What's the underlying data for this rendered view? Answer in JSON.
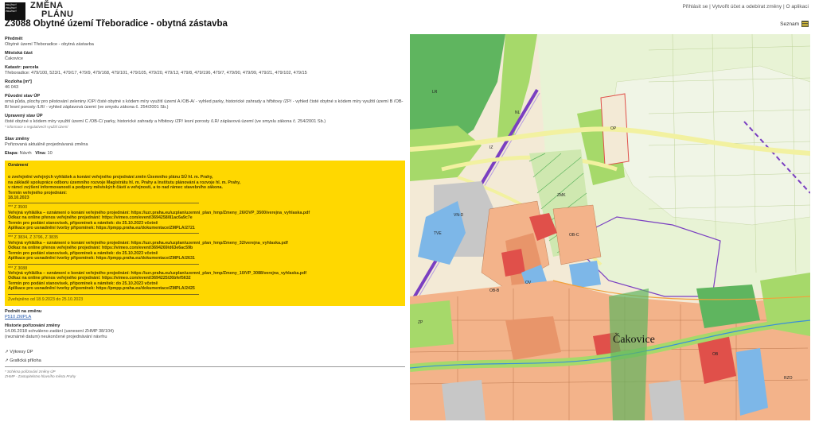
{
  "header": {
    "logo_words": [
      "PRAŽSKÝ",
      "PRAŽSKÝ",
      "PRAŽSKÝ"
    ],
    "logo_line1": "ZMĚNA",
    "logo_line2": "PLÁNU",
    "title": "Z3088 Obytné území Třeboradice - obytná zástavba",
    "top_links": "Přihlásit se | Vytvořit účet a odebírat změny | O aplikaci",
    "seznam": "Seznam"
  },
  "details": {
    "predmet_label": "Předmět",
    "predmet_value": "Obytné území Třeboradice - obytná zástavba",
    "mestska_label": "Městská část",
    "mestska_value": "Čakovice",
    "katastr_label": "Katastr: parcela",
    "katastr_value": "Třeboradice: 479/100, 523/1, 479/17, 479/9, 479/168, 479/101, 479/105, 479/20, 479/13, 479/8, 479/196, 479/7, 479/90, 479/99, 479/21, 479/102, 479/15",
    "rozloha_label": "Rozloha [m²]",
    "rozloha_value": "46 043",
    "puvodni_label": "Původní stav ÚP",
    "puvodni_value": "orná půda, plochy pro pěstování zeleniny /OP/ čisté obytné s kódem míry využití území A /OB-A/ - vyhled parky, historické zahrady a hřbitovy /ZP/ - vyhled čisté obytné s kódem míry využití území B /OB-B/ lesní porosty /LR/ - vyhled záplavová území (ve smyslu zákona č. 254/2001 Sb.)",
    "upraveny_label": "Upravený stav ÚP",
    "upraveny_value": "čisté obytné s kódem míry využití území C /OB-C/ parky, historické zahrady a hřbitovy /ZP/ lesní porosty /LR/ záplavová území (ve smyslu zákona č. 254/2001 Sb.)",
    "upraveny_note": "* informace o regulativech využití území",
    "stav_label": "Stav změny",
    "stav_value": "Pořizovaná aktuálně projednávaná změna",
    "etapa_label": "Etapa:",
    "etapa_value": "Návrh",
    "vlna_label": "Vlna:",
    "vlna_value": "10"
  },
  "notice": {
    "title": "Oznámení",
    "intro": [
      "o zveřejnění veřejných vyhlášek a konání veřejného projednání změn Územního plánu SÚ hl. m. Prahy,",
      "na základě spolupráce odboru územního rozvoje Magistrátu hl. m. Prahy a Institutu plánování a rozvoje hl. m. Prahy,",
      "v rámci zvýšení informovanosti a podpory městských částí a veřejnosti, a to nad rámec stavebního zákona.",
      "Termín veřejného projednání:",
      "18.10.2023"
    ],
    "blocks": [
      {
        "stars": "*** Z 3500",
        "lines": [
          "Veřejná vyhláška – oznámení o konání veřejného projednání: https://uzr.praha.eu/uzplan/uzemni_plan_hmp/Zmeny_26/OVP_3500/verejna_vyhlaska.pdf",
          "Odkaz na online přenos veřejného projednání: https://vimeo.com/event/3694258/81ac6a9c7e",
          "Termín pro podání stanovisek, připomínek a námitek: do 25.10.2023 včetně",
          "Aplikace pro usnadnění tvorby připomínek: https://pmpp.praha.eu/dokumentace/ZMPLA/2721"
        ]
      },
      {
        "stars": "*** Z 3834, Z 3796, Z 3835",
        "lines": [
          "Veřejná vyhláška – oznámení o konání veřejného projednání: https://uzr.praha.eu/uzplan/uzemni_plan_hmp/Zmeny_32/verejna_vyhlaska.pdf",
          "Odkaz na online přenos veřejného projednání: https://vimeo.com/event/3694269/d63e6ac59b",
          "Termín pro podání stanovisek, připomínek a námitek: do 25.10.2023 včetně",
          "Aplikace pro usnadnění tvorby připomínek: https://pmpp.praha.eu/dokumentace/ZMPLA/2631"
        ]
      },
      {
        "stars": "*** Z 3088",
        "lines": [
          "Veřejná vyhláška – oznámení o konání veřejného projednání: https://uzr.praha.eu/uzplan/uzemni_plan_hmp/Zmeny_10/VP_3088/verejna_vyhlaska.pdf",
          "Odkaz na online přenos veřejného projednání: https://vimeo.com/event/3694225/26bfef5632",
          "Termín pro podání stanovisek, připomínek a námitek: do 25.10.2023 včetně",
          "Aplikace pro usnadnění tvorby připomínek: https://pmpp.praha.eu/dokumentace/ZMPLA/2425"
        ]
      }
    ],
    "published": "Zveřejněno od 18.9.2023 do 25.10.2023"
  },
  "footer": {
    "podnet_label": "Podnět na změnu",
    "podnet_link": "P510 ZMPLA",
    "historie_label": "Historie pořizování změny",
    "historie_line1": "14.06.2018 schváleno zadání (usnesení ZHMP 38/104)",
    "historie_line2": "(neznámé datum) neukončené projednávání návrhu",
    "vykresy": "↗ Výkresy ÚP",
    "graficka": "↗ Grafická příloha",
    "schema_note": "* Schéma pořizování změny ÚP",
    "zhmp_note": "ZHMP - Zastupitelstvo hlavního města Prahy"
  },
  "map": {
    "place_label": "Čakovice",
    "zone_labels": [
      "LR",
      "NL",
      "OP",
      "OB-B",
      "OB-C",
      "ZP",
      "ZMK",
      "VN-D",
      "TVE",
      "OV",
      "OB",
      "IZ",
      "RZO"
    ],
    "colors": {
      "residential": "#f3b38a",
      "residential_dark": "#e8956a",
      "green": "#a6d96a",
      "forest": "#5fb55f",
      "meadow": "#d9eeb5",
      "water": "#7db7e8",
      "road": "#f2f1a0",
      "industry": "#c7c7c7",
      "accent_violet": "#7a3fc1",
      "commercial_red": "#e0504a",
      "orange_line": "#f2a13b"
    }
  }
}
